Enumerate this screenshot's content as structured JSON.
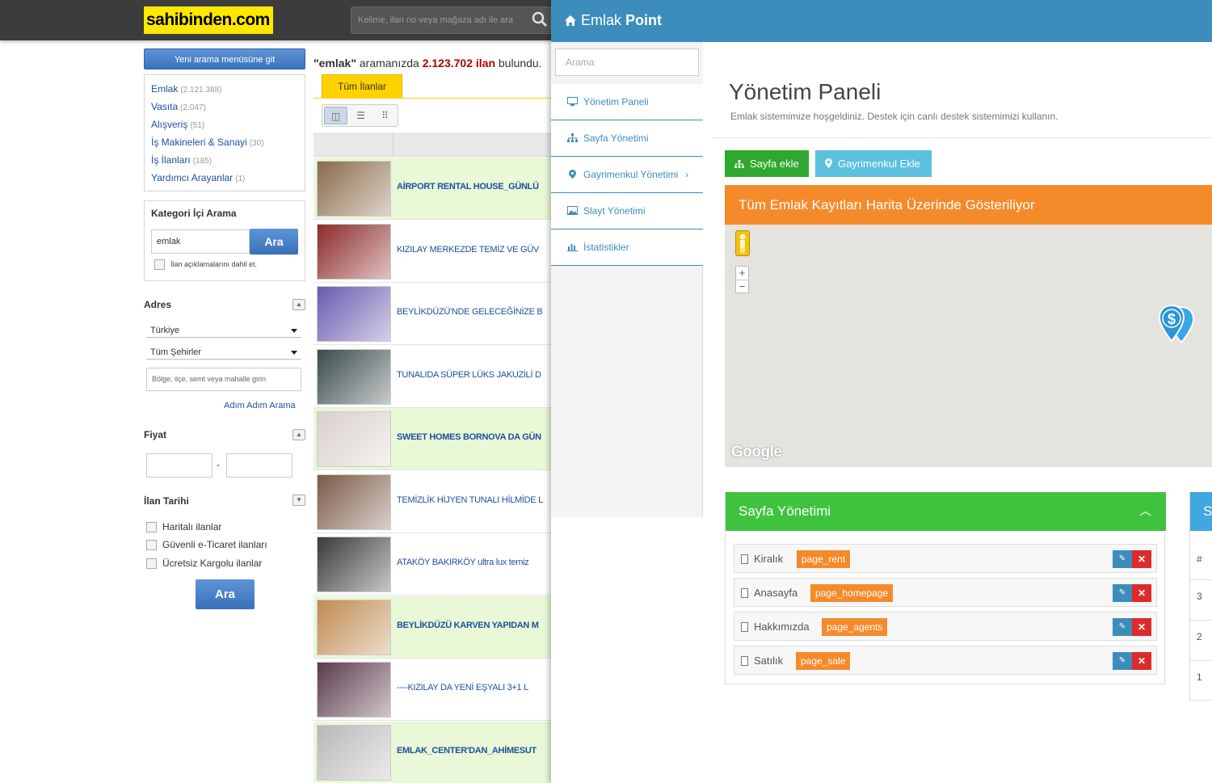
{
  "site": {
    "logo": "sahibinden.com",
    "search_placeholder": "Kelime, ilan no veya mağaza adı ile ara",
    "new_search_button": "Yeni arama menüsüne git",
    "categories": [
      {
        "label": "Emlak",
        "count": "(2.121.388)"
      },
      {
        "label": "Vasıta",
        "count": "(2.047)"
      },
      {
        "label": "Alışveriş",
        "count": "(51)"
      },
      {
        "label": "İş Makineleri & Sanayi",
        "count": "(30)"
      },
      {
        "label": "İş İlanları",
        "count": "(185)"
      },
      {
        "label": "Yardımcı Arayanlar",
        "count": "(1)"
      }
    ],
    "category_search": {
      "title": "Kategori İçi Arama",
      "value": "emlak",
      "button": "Ara",
      "include_desc": "İlan açıklamalarını dahil et."
    },
    "address": {
      "title": "Adres",
      "country": "Türkiye",
      "city": "Tüm Şehirler",
      "region_placeholder": "Bölge, ilçe, semt veya mahalle girin",
      "step_link": "Adım Adım Arama"
    },
    "price": {
      "title": "Fiyat",
      "separator": "-"
    },
    "date": {
      "title": "İlan Tarihi"
    },
    "filters": [
      "Haritalı ilanlar",
      "Güvenli e-Ticaret ilanları",
      "Ücretsiz Kargolu ilanlar"
    ],
    "search_button": "Ara",
    "result": {
      "query": "\"emlak\"",
      "middle": " aramanızda ",
      "count": "2.123.702 ilan",
      "suffix": " bulundu."
    },
    "tab_all": "Tüm İlanlar",
    "listings": [
      {
        "title": "AİRPORT RENTAL HOUSE_GÜNLÜ",
        "highlight": true,
        "bold": true,
        "thumb": "#8a6a4a"
      },
      {
        "title": "KIZILAY MERKEZDE TEMİZ VE GÜV",
        "highlight": false,
        "bold": false,
        "thumb": "#8c2a2a"
      },
      {
        "title": "BEYLİKDÜZÜ'NDE GELECEĞİNİZE B",
        "highlight": false,
        "bold": false,
        "thumb": "#6a5ab0"
      },
      {
        "title": "TUNALIDA SÜPER LÜKS JAKUZİLİ D",
        "highlight": false,
        "bold": false,
        "thumb": "#3a4a4a"
      },
      {
        "title": "SWEET HOMES BORNOVA DA GÜN",
        "highlight": true,
        "bold": true,
        "thumb": "#d8d0cc"
      },
      {
        "title": "TEMİZLİK HİJYEN TUNALI HİLMİDE L",
        "highlight": false,
        "bold": false,
        "thumb": "#7a5a48"
      },
      {
        "title": "ATAKÖY BAKIRKÖY ultra lux temiz",
        "highlight": false,
        "bold": false,
        "thumb": "#3a3a3a"
      },
      {
        "title": "BEYLİKDÜZÜ KARVEN YAPIDAN M",
        "highlight": true,
        "bold": true,
        "thumb": "#c08a50"
      },
      {
        "title": "----KIZILAY DA YENİ EŞYALI 3+1 L",
        "highlight": false,
        "bold": false,
        "thumb": "#5a3a4a"
      },
      {
        "title": "EMLAK_CENTER'DAN_AHİMESUT",
        "highlight": true,
        "bold": true,
        "thumb": "#b8b8bc"
      }
    ]
  },
  "admin": {
    "brand_light": "Emlak ",
    "brand_bold": "Point",
    "search_placeholder": "Arama",
    "nav": [
      {
        "label": "Yönetim Paneli",
        "icon": "desktop-icon"
      },
      {
        "label": "Sayfa Yönetimi",
        "icon": "sitemap-icon"
      },
      {
        "label": "Gayrimenkul Yönetimi",
        "icon": "map-marker-icon",
        "chevron": "›"
      },
      {
        "label": "Slayt Yönetimi",
        "icon": "image-icon"
      },
      {
        "label": "İstatistikler",
        "icon": "bar-chart-icon"
      }
    ],
    "title": "Yönetim Paneli",
    "subtitle": "Emlak sistemimize hoşgeldiniz. Destek için canlı destek sistemimizi kullanın.",
    "add_page_button": "Sayfa ekle",
    "add_property_button": "Gayrimenkul Ekle",
    "map_title": "Tüm Emlak Kayıtları Harita Üzerinde Gösteriliyor",
    "map_zoom_in": "+",
    "map_zoom_out": "−",
    "map_attribution": "Google",
    "page_card": {
      "title": "Sayfa Yönetimi",
      "pages": [
        {
          "name": "Kiralık",
          "tag": "page_rent"
        },
        {
          "name": "Anasayfa",
          "tag": "page_homepage"
        },
        {
          "name": "Hakkımızda",
          "tag": "page_agents"
        },
        {
          "name": "Satılık",
          "tag": "page_sale"
        }
      ]
    },
    "side_card": {
      "title": "S",
      "header": "#",
      "rows": [
        "3",
        "2",
        "1"
      ]
    },
    "colors": {
      "header_blue": "#3c8dbc",
      "green": "#3fc33f",
      "orange": "#f58a2b",
      "light_blue": "#5bc0de",
      "red": "#dd2b2b"
    }
  }
}
